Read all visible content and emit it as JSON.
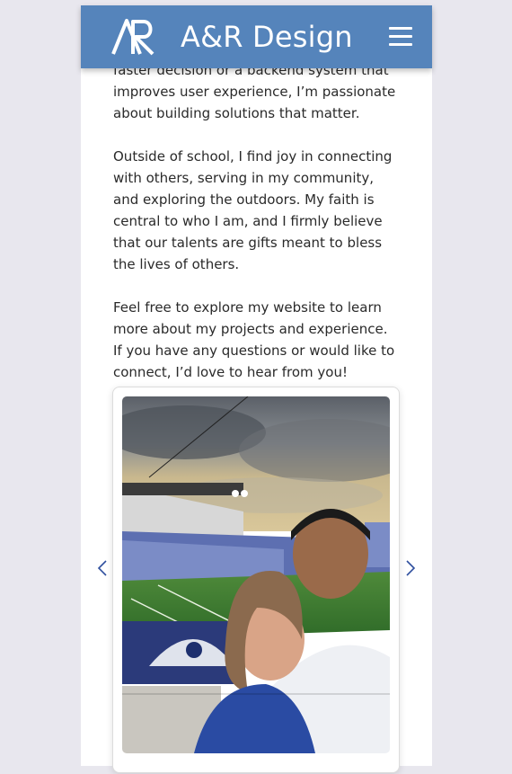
{
  "header": {
    "logo_text": "AR",
    "brand": "A&R Design"
  },
  "about": {
    "paragraphs": [
      "faster decision or a backend system that improves user experience, I’m passionate about building solutions that matter.",
      "Outside of school, I find joy in connecting with others, serving in my community, and exploring the outdoors. My faith is central to who I am, and I firmly believe that our talents are gifts meant to bless the lives of others.",
      "Feel free to explore my website to learn more about my projects and experience. If you have any questions or would like to connect, I’d love to hear from you!"
    ]
  },
  "carousel": {
    "photo_description_icon": "photo-stadium-selfie",
    "prev_icon": "chevron-left-icon",
    "next_icon": "chevron-right-icon"
  },
  "colors": {
    "header_bg": "#5584bb",
    "page_bg": "#e8e7ee",
    "arrow": "#2f4f9e"
  }
}
